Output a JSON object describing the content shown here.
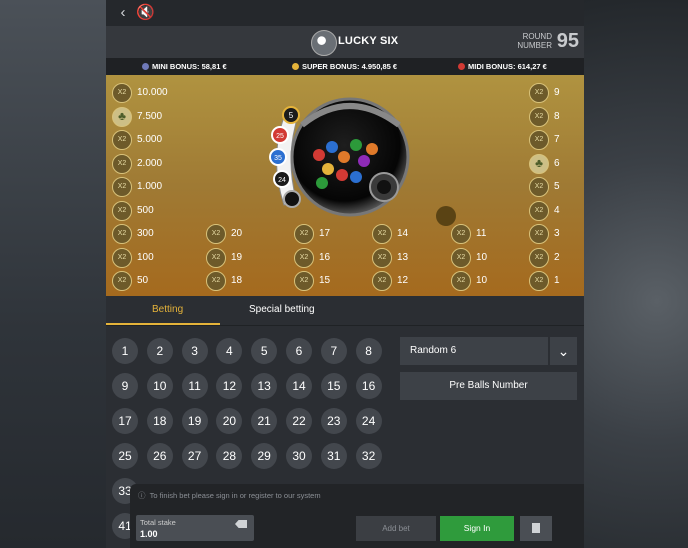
{
  "header": {
    "title": "LUCKY SIX",
    "round_label_1": "ROUND",
    "round_label_2": "NUMBER",
    "round_number": "95"
  },
  "bonuses": [
    {
      "label": "MINI BONUS:",
      "value": "58,81 €",
      "color": "#6f79b8"
    },
    {
      "label": "SUPER BONUS:",
      "value": "4.950,85 €",
      "color": "#e5b33a"
    },
    {
      "label": "MIDI BONUS:",
      "value": "614,27 €",
      "color": "#d23a34"
    }
  ],
  "odds_left": [
    "10.000",
    "7.500",
    "5.000",
    "2.000",
    "1.000",
    "500",
    "300",
    "100",
    "50"
  ],
  "odds_mid": [
    [
      "20",
      "19",
      "18"
    ],
    [
      "17",
      "16",
      "15"
    ],
    [
      "14",
      "13",
      "12"
    ],
    [
      "11",
      "10",
      "10"
    ]
  ],
  "odds_right": [
    "9",
    "8",
    "7",
    "6",
    "5",
    "4",
    "3",
    "2",
    "1"
  ],
  "chip_label": "X2",
  "drawn_balls": [
    "5",
    "25",
    "35",
    "24"
  ],
  "tabs": [
    "Betting",
    "Special betting"
  ],
  "numbers": [
    "1",
    "2",
    "3",
    "4",
    "5",
    "6",
    "7",
    "8",
    "9",
    "10",
    "11",
    "12",
    "13",
    "14",
    "15",
    "16",
    "17",
    "18",
    "19",
    "20",
    "21",
    "22",
    "23",
    "24",
    "25",
    "26",
    "27",
    "28",
    "29",
    "30",
    "31",
    "32",
    "33",
    "41"
  ],
  "select_value": "Random 6",
  "pre_balls": "Pre Balls Number",
  "info_text": "To finish bet please sign in or register to our system",
  "stake_label": "Total stake",
  "stake_value": "1.00",
  "add_bet": "Add bet",
  "sign_in": "Sign In"
}
